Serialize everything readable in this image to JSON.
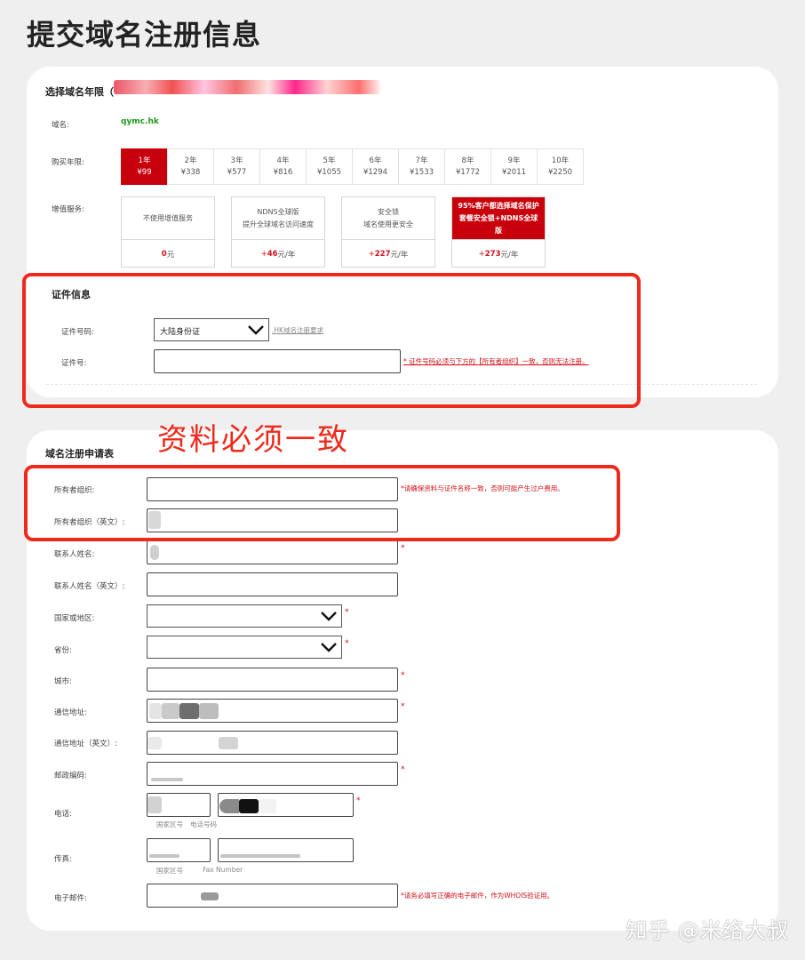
{
  "page_title": "提交域名注册信息",
  "period_section": {
    "title": "选择域名年限（",
    "domain_label": "域名:",
    "domain_value": "qymc.hk",
    "years_label": "购买年限:",
    "years": [
      {
        "label": "1年",
        "price": "¥99",
        "selected": true
      },
      {
        "label": "2年",
        "price": "¥338"
      },
      {
        "label": "3年",
        "price": "¥577"
      },
      {
        "label": "4年",
        "price": "¥816"
      },
      {
        "label": "5年",
        "price": "¥1055"
      },
      {
        "label": "6年",
        "price": "¥1294"
      },
      {
        "label": "7年",
        "price": "¥1533"
      },
      {
        "label": "8年",
        "price": "¥1772"
      },
      {
        "label": "9年",
        "price": "¥2011"
      },
      {
        "label": "10年",
        "price": "¥2250"
      }
    ],
    "services_label": "增值服务:",
    "services": [
      {
        "desc": "不使用增值服务",
        "price_num": "0",
        "price_unit": "元",
        "price_prefix": ""
      },
      {
        "desc": "NDNS全球版\n提升全球域名访问速度",
        "price_num": "46",
        "price_unit": "元/年",
        "price_prefix": "+"
      },
      {
        "desc": "安全锁\n域名使用更安全",
        "price_num": "227",
        "price_unit": "元/年",
        "price_prefix": "+"
      },
      {
        "desc": "95%客户都选择域名保护套餐安全锁+NDNS全球版",
        "price_num": "273",
        "price_unit": "元/年",
        "price_prefix": "+"
      }
    ]
  },
  "cert_section": {
    "title": "证件信息",
    "type_label": "证件号码:",
    "type_value": "大陆身份证",
    "type_link": ".HK域名注册要求",
    "number_label": "证件号:",
    "number_note": "* 证件号码必须与下方的【所有者组织】一致，否则无法注册。"
  },
  "annotation": {
    "text": "资料必须一致"
  },
  "form": {
    "title": "域名注册申请表",
    "owner_org_label": "所有者组织:",
    "owner_org_note": "*请确保资料与证件名称一致，否则可能产生过户费用。",
    "owner_org_en_label": "所有者组织（英文）:",
    "contact_label": "联系人姓名:",
    "contact_en_label": "联系人姓名（英文）:",
    "country_label": "国家或地区:",
    "province_label": "省份:",
    "city_label": "城市:",
    "address_label": "通信地址:",
    "address_en_label": "通信地址（英文）:",
    "zip_label": "邮政编码:",
    "phone_label": "电话:",
    "phone_sub_area": "国家区号",
    "phone_sub_number": "电话号码",
    "fax_label": "传真:",
    "fax_sub_area": "国家区号",
    "fax_sub_number": "Fax Number",
    "email_label": "电子邮件:",
    "email_note": "*请务必填写正确的电子邮件，作为WHOIS验证用。",
    "required_mark": "*"
  },
  "watermark": "知乎 @米络大叔",
  "colors": {
    "accent_red": "#c8000b",
    "annotation_red": "#ee2a1c",
    "domain_green": "#1a9a1a"
  }
}
